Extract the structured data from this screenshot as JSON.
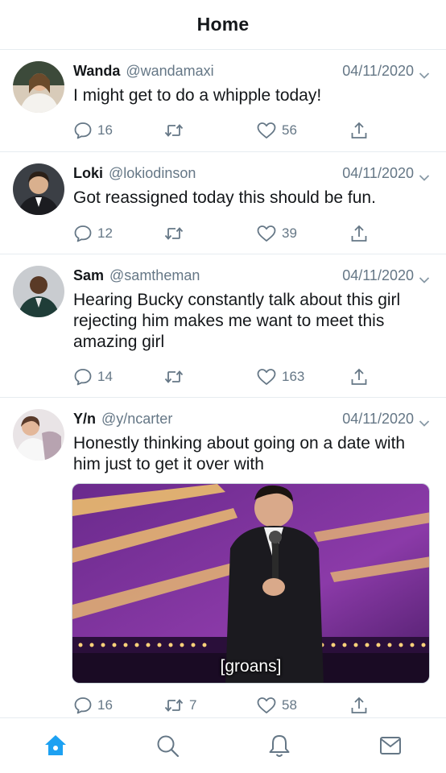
{
  "header": {
    "title": "Home"
  },
  "tweets": [
    {
      "name": "Wanda",
      "handle": "@wandamaxi",
      "date": "04/11/2020",
      "text": "I might get to do a whipple today!",
      "replies": "16",
      "retweets": "",
      "likes": "56"
    },
    {
      "name": "Loki",
      "handle": "@lokiodinson",
      "date": "04/11/2020",
      "text": "Got reassigned today this should be fun.",
      "replies": "12",
      "retweets": "",
      "likes": "39"
    },
    {
      "name": "Sam",
      "handle": "@samtheman",
      "date": "04/11/2020",
      "text": "Hearing Bucky constantly talk about this girl rejecting him makes me want to meet this amazing girl",
      "replies": "14",
      "retweets": "",
      "likes": "163"
    },
    {
      "name": "Y/n",
      "handle": "@y/ncarter",
      "date": "04/11/2020",
      "text": "Honestly thinking about going on a date with him just to get it over with",
      "media_caption": "[groans]",
      "replies": "16",
      "retweets": "7",
      "likes": "58"
    }
  ],
  "tabbar": {
    "active": "home",
    "icons": [
      "home-icon",
      "search-icon",
      "notifications-bell-icon",
      "messages-envelope-icon"
    ]
  },
  "colors": {
    "accent": "#1da1f2",
    "secondary_text": "#657786",
    "divider": "#e6ecf0"
  }
}
